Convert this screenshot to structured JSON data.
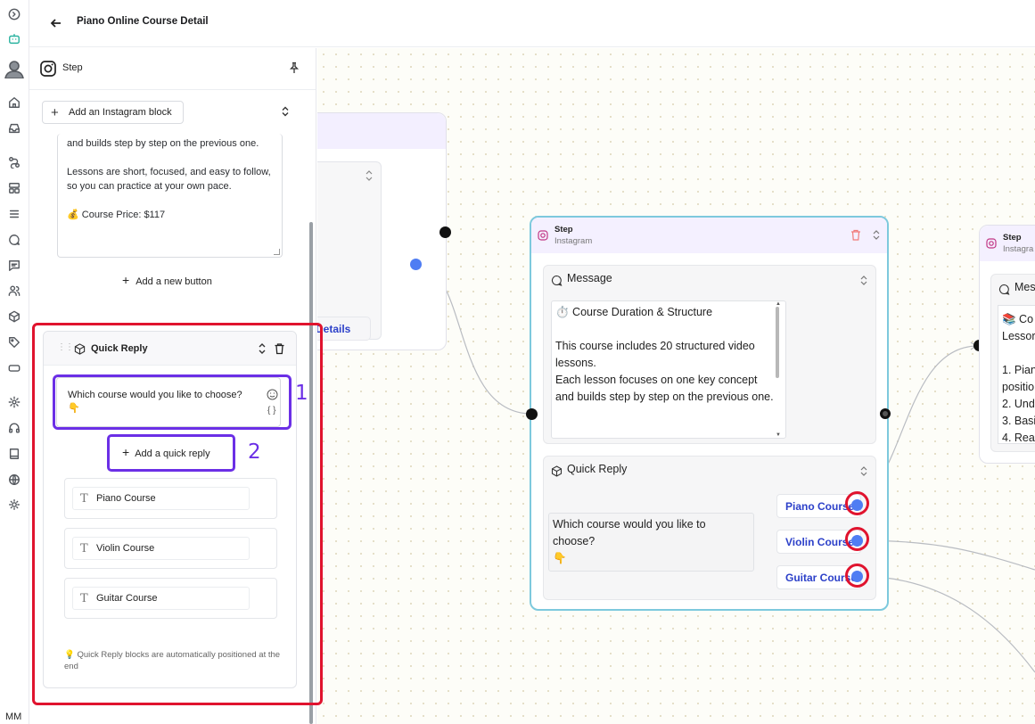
{
  "header": {
    "title": "Piano Online Course Detail"
  },
  "rail": {
    "icons": [
      "collapse-icon",
      "bot-icon",
      "user-avatar-icon",
      "home-icon",
      "inbox-icon",
      "flow-icon",
      "layout-icon",
      "list-icon",
      "chat-icon",
      "message-square-icon",
      "contacts-icon",
      "cube-icon",
      "tag-icon",
      "toggle-icon",
      "settings-icon",
      "headset-icon",
      "book-icon",
      "globe-icon",
      "sun-icon"
    ],
    "user_initials": "MM"
  },
  "panel": {
    "title": "Step",
    "add_block_label": "Add an Instagram block",
    "message_text": "and builds step by step on the previous one.\n\nLessons are short, focused, and easy to follow, so you can practice at your own pace.\n\n💰 Course Price: $117",
    "add_button_label": "Add a new button",
    "quick_reply": {
      "title": "Quick Reply",
      "text": "Which course would you like to choose?\n👇",
      "braces": "{ }",
      "add_label": "Add a quick reply",
      "items": [
        "Piano Course",
        "Violin Course",
        "Guitar Course"
      ],
      "note": "💡 Quick Reply blocks are automatically positioned at the end"
    }
  },
  "annotations": {
    "label_1": "1",
    "label_2": "2"
  },
  "canvas": {
    "left_node": {
      "button": "More Details"
    },
    "center_node": {
      "step_label": "Step",
      "channel": "Instagram",
      "message_title": "Message",
      "message_text": "⏱️ Course Duration & Structure\n\nThis course includes 20 structured video lessons.\nEach lesson focuses on one key concept and builds step by step on the previous one.",
      "quick_reply_title": "Quick Reply",
      "quick_reply_text": "Which course would you like to choose?\n👇",
      "buttons": [
        "Piano Course",
        "Violin Course",
        "Guitar Course"
      ]
    },
    "right_node": {
      "step_label": "Step",
      "channel": "Instagra",
      "message_title": "Mes",
      "message_text": "📚 Co\nLessor\n\n1. Pian\npositio\n2. Unde\n3. Basi\n4. Reac"
    }
  },
  "colors": {
    "annotation_red": "#e0132e",
    "annotation_purple": "#6b2fe6",
    "link_blue": "#2c40c9",
    "node_border_active": "#7dc9dd",
    "port_blue": "#4f7df3"
  }
}
